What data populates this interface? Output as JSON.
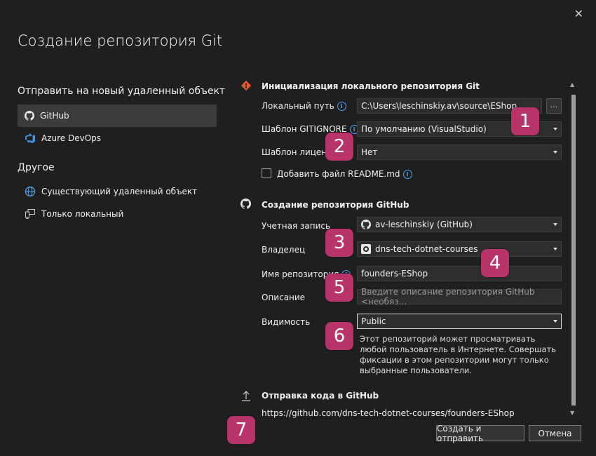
{
  "window": {
    "title": "Создание репозитория Git",
    "close_glyph": "✕"
  },
  "nav": {
    "push_heading": "Отправить на новый удаленный объект",
    "push_items": [
      {
        "label": "GitHub",
        "icon": "github-icon",
        "selected": true
      },
      {
        "label": "Azure DevOps",
        "icon": "azure-devops-icon",
        "selected": false
      }
    ],
    "other_heading": "Другое",
    "other_items": [
      {
        "label": "Существующий удаленный объект",
        "icon": "globe-icon"
      },
      {
        "label": "Только локальный",
        "icon": "local-computer-icon"
      }
    ]
  },
  "local_repo": {
    "heading": "Инициализация локального репозитория Git",
    "path_label": "Локальный путь",
    "path_value": "C:\\Users\\leschinskiy.av\\source\\EShop",
    "browse_label": "...",
    "gitignore_label": "Шаблон GITIGNORE",
    "gitignore_value": "По умолчанию (VisualStudio)",
    "license_label": "Шаблон лицензии",
    "license_value": "Нет",
    "readme_label": "Добавить файл README.md",
    "readme_checked": false
  },
  "github": {
    "heading": "Создание репозитория GitHub",
    "account_label": "Учетная запись",
    "account_value": "av-leschinskiy (GitHub)",
    "owner_label": "Владелец",
    "owner_value": "dns-tech-dotnet-courses",
    "repo_name_label": "Имя репозитория",
    "repo_name_value": "founders-EShop",
    "description_label": "Описание",
    "description_placeholder": "Введите описание репозитория GitHub <необяз...",
    "visibility_label": "Видимость",
    "visibility_value": "Public",
    "visibility_note": "Этот репозиторий может просматривать любой пользователь в Интернете. Совершать фиксации в этом репозитории могут только выбранные пользователи."
  },
  "push": {
    "heading": "Отправка кода в GitHub",
    "url": "https://github.com/dns-tech-dotnet-courses/founders-EShop"
  },
  "buttons": {
    "create_push": "Создать и отправить",
    "cancel": "Отмена"
  },
  "callouts": [
    "1",
    "2",
    "3",
    "4",
    "5",
    "6",
    "7"
  ],
  "colors": {
    "background": "#1f1f1f",
    "callout": "#b8336a",
    "info_accent": "#4aa3ff",
    "selected_nav": "#3b3b3b"
  }
}
